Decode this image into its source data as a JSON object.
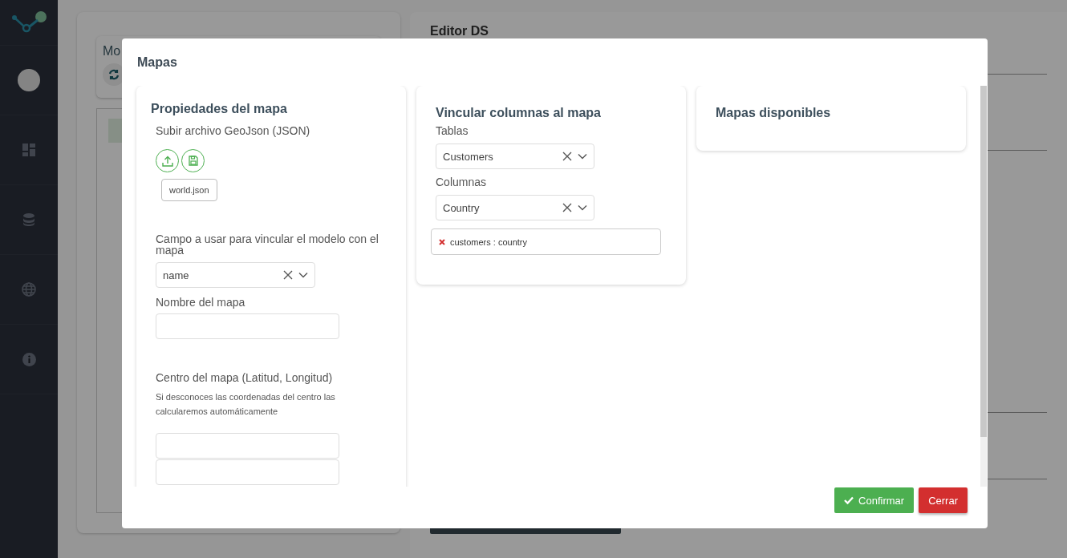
{
  "background": {
    "left_panel_title": "Mo",
    "right_panel_title": "Editor DS"
  },
  "modal": {
    "title": "Mapas",
    "properties_card": {
      "title": "Propiedades del mapa",
      "upload_label": "Subir archivo GeoJson (JSON)",
      "file_name": "world.json",
      "link_field": {
        "label": "Campo a usar para vincular el modelo con el mapa",
        "value": "name"
      },
      "map_name": {
        "label": "Nombre del mapa"
      },
      "center": {
        "label": "Centro del mapa (Latitud, Longitud)",
        "hint": "Si desconoces las coordenadas del centro las calcularemos automáticamente"
      }
    },
    "link_card": {
      "title": "Vincular columnas al mapa",
      "selects": [
        {
          "label": "Tablas",
          "value": "Customers"
        },
        {
          "label": "Columnas",
          "value": "Country"
        }
      ],
      "chips": [
        {
          "label": "customers : country"
        }
      ]
    },
    "maps_card": {
      "title": "Mapas disponibles"
    },
    "buttons": [
      {
        "label": "Confirmar",
        "kind": "confirm"
      },
      {
        "label": "Cerrar",
        "kind": "close"
      }
    ]
  }
}
